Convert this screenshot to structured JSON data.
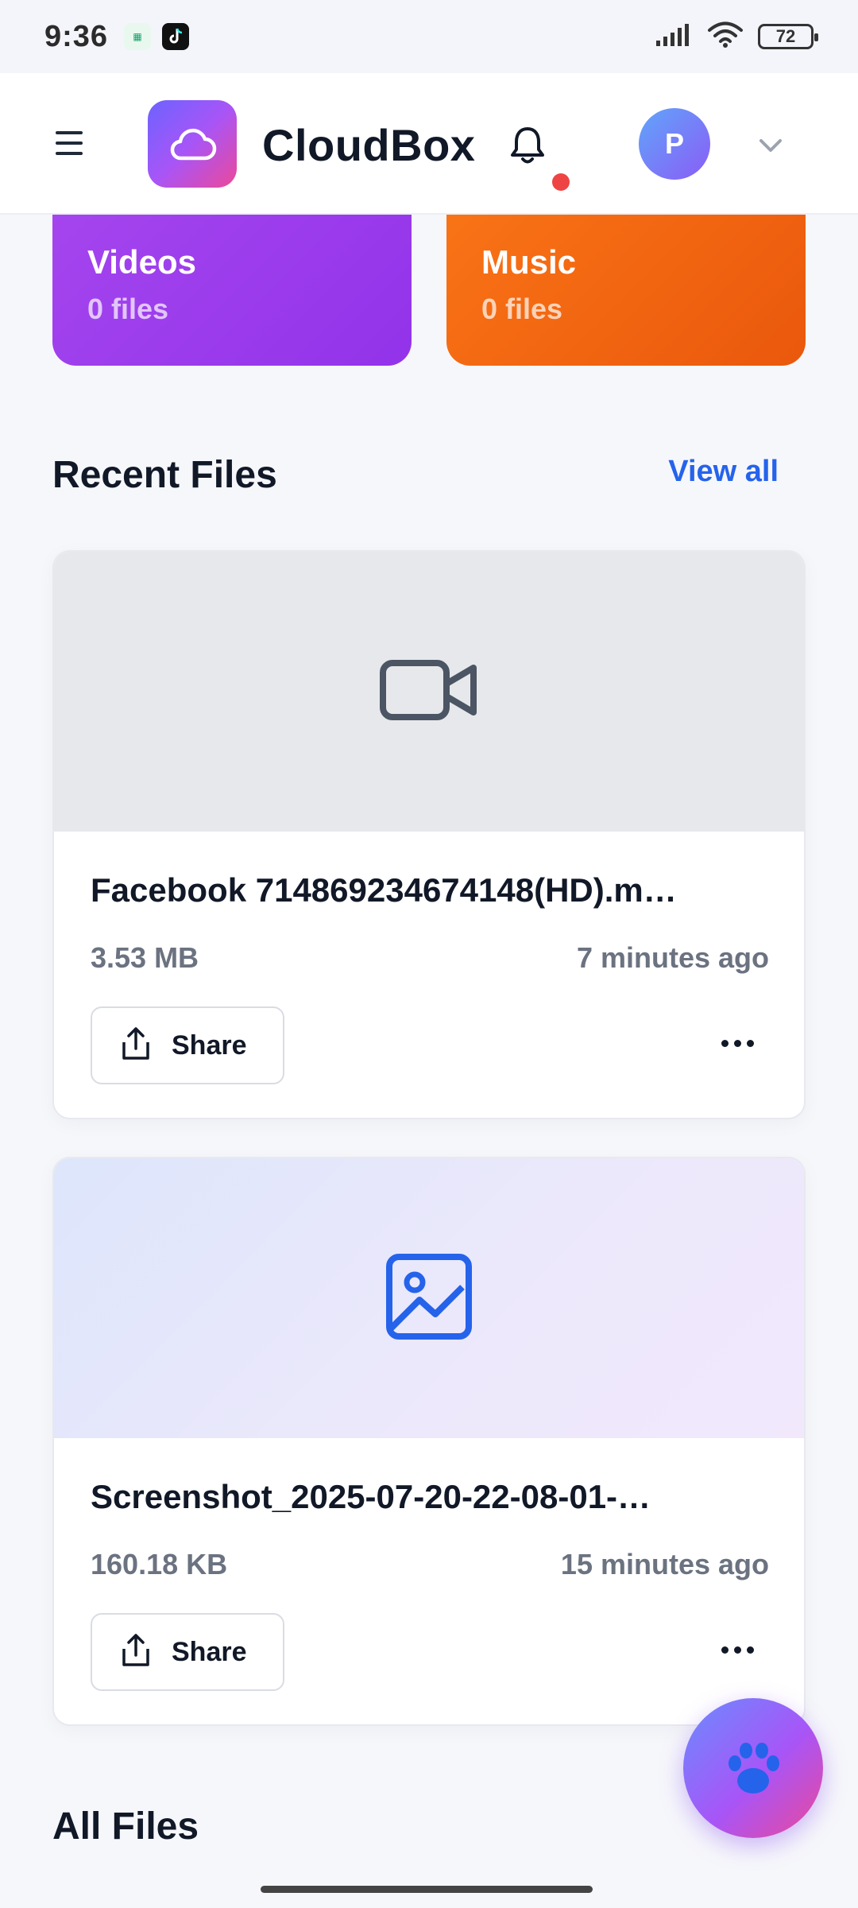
{
  "status_bar": {
    "time": "9:36",
    "battery": "72",
    "icons": [
      "cellular-signal-icon",
      "wifi-icon",
      "battery-icon"
    ]
  },
  "header": {
    "app_name": "CloudBox",
    "avatar_initial": "P",
    "notification_dot_color": "#ef4444"
  },
  "categories": [
    {
      "title": "Videos",
      "count": "0 files",
      "color": "#9333ea"
    },
    {
      "title": "Music",
      "count": "0 files",
      "color": "#f97316"
    }
  ],
  "recent": {
    "title": "Recent Files",
    "view_all": "View all",
    "files": [
      {
        "name": "Facebook 714869234674148(HD).m…",
        "size": "3.53 MB",
        "time": "7 minutes ago",
        "share": "Share",
        "type_icon": "video-camera-icon"
      },
      {
        "name": "Screenshot_2025-07-20-22-08-01-…",
        "size": "160.18 KB",
        "time": "15 minutes ago",
        "share": "Share",
        "type_icon": "image-icon"
      }
    ]
  },
  "all_files": {
    "title": "All Files"
  },
  "fab": {
    "icon": "paw-icon"
  },
  "colors": {
    "accent": "#2563eb",
    "brand_gradient_start": "#6c63ff",
    "brand_gradient_end": "#ec4899"
  }
}
